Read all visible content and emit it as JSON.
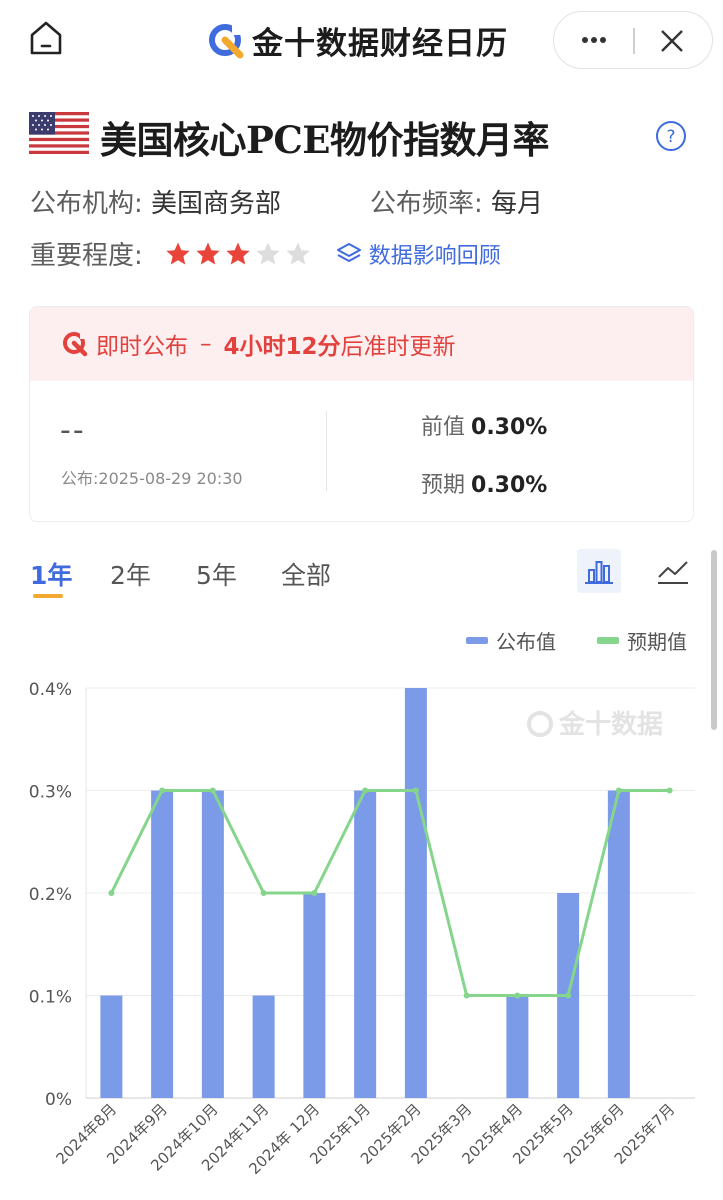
{
  "header": {
    "brand_title": "金十数据财经日历"
  },
  "indicator": {
    "title": "美国核心PCE物价指数月率",
    "publisher_label": "公布机构:",
    "publisher": "美国商务部",
    "frequency_label": "公布频率:",
    "frequency": "每月",
    "importance_label": "重要程度:",
    "importance_stars": 3,
    "importance_max": 5,
    "review_link": "数据影响回顾"
  },
  "release": {
    "status": "即时公布",
    "countdown": "4小时12分",
    "countdown_suffix": "后准时更新",
    "actual": "--",
    "publish_time": "公布:2025-08-29 20:30",
    "previous_label": "前值",
    "previous": "0.30%",
    "forecast_label": "预期",
    "forecast": "0.30%"
  },
  "tabs": [
    {
      "label": "1年",
      "active": true
    },
    {
      "label": "2年",
      "active": false
    },
    {
      "label": "5年",
      "active": false
    },
    {
      "label": "全部",
      "active": false
    }
  ],
  "colors": {
    "accent": "#3f6bdf",
    "alert": "#e2413d",
    "bar": "#7b9be8",
    "line": "#86d58c",
    "star_on": "#e8443a",
    "star_off": "#dddddd",
    "tab_underline": "#f3a92d"
  },
  "chart_data": {
    "type": "bar",
    "watermark": "金十数据",
    "legend": "top-right",
    "ylim": [
      0,
      0.4
    ],
    "y_ticks": [
      "0%",
      "0.1%",
      "0.2%",
      "0.3%",
      "0.4%"
    ],
    "categories": [
      "2024年8月",
      "2024年9月",
      "2024年10月",
      "2024年11月",
      "2024年 12月",
      "2025年1月",
      "2025年2月",
      "2025年3月",
      "2025年4月",
      "2025年5月",
      "2025年6月",
      "2025年7月"
    ],
    "series": [
      {
        "name": "公布值",
        "type": "bar",
        "values": [
          0.1,
          0.3,
          0.3,
          0.1,
          0.2,
          0.3,
          0.4,
          0.0,
          0.1,
          0.2,
          0.3,
          null
        ]
      },
      {
        "name": "预期值",
        "type": "line",
        "values": [
          0.2,
          0.3,
          0.3,
          0.2,
          0.2,
          0.3,
          0.3,
          0.1,
          0.1,
          0.1,
          0.3,
          0.3
        ]
      }
    ]
  }
}
